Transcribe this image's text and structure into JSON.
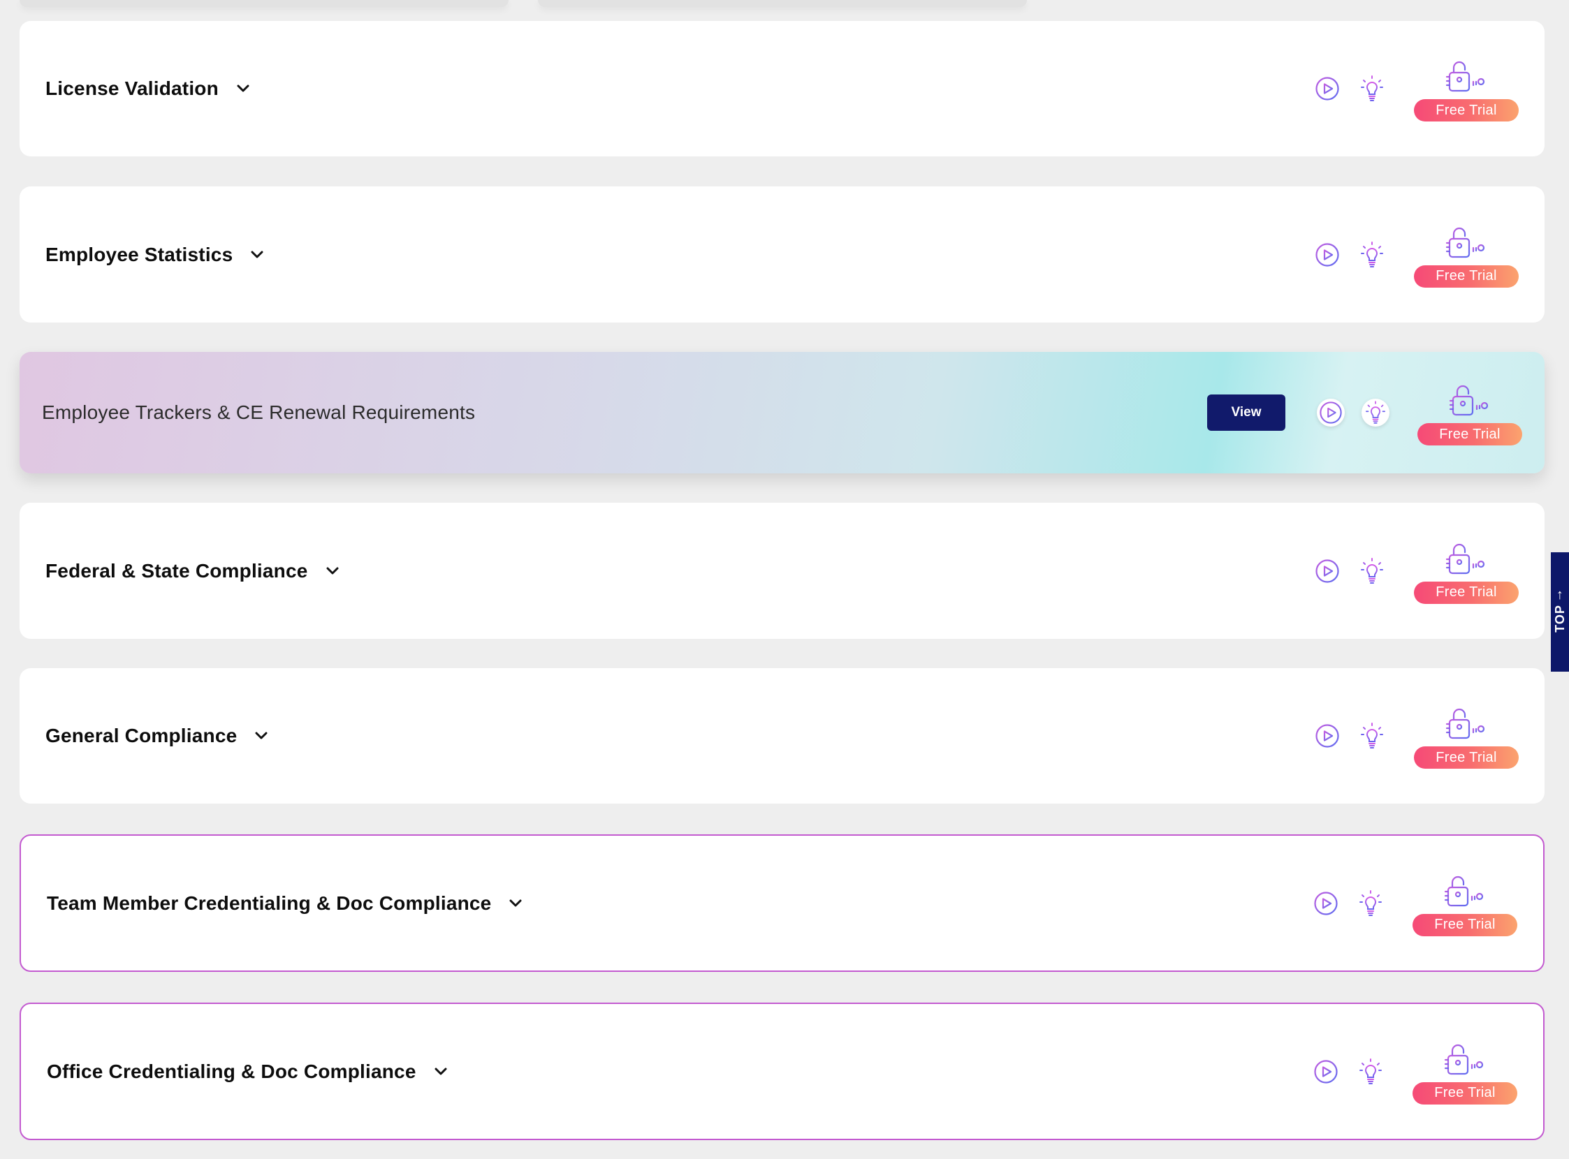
{
  "colors": {
    "page_background": "#eeeeee",
    "card_background": "#ffffff",
    "outline_accent": "#c35ad0",
    "trial_gradient_start": "#f64a77",
    "trial_gradient_end": "#fba36e",
    "view_button": "#111a6b",
    "top_tab": "#0d1869",
    "icon_purple": "#8c5cf0"
  },
  "icons": {
    "expand": "chevron-down-icon",
    "video": "play-icon",
    "tips": "lightbulb-icon",
    "locked": "lock-key-icon"
  },
  "rows": [
    {
      "title": "License Validation",
      "trial_label": "Free Trial"
    },
    {
      "title": "Employee Statistics",
      "trial_label": "Free Trial"
    },
    {
      "title": "Employee Trackers & CE Renewal Requirements",
      "view_label": "View",
      "trial_label": "Free Trial"
    },
    {
      "title": "Federal & State Compliance",
      "trial_label": "Free Trial"
    },
    {
      "title": "General Compliance",
      "trial_label": "Free Trial"
    },
    {
      "title": "Team Member Credentialing & Doc Compliance",
      "trial_label": "Free Trial"
    },
    {
      "title": "Office Credentialing & Doc Compliance",
      "trial_label": "Free Trial"
    }
  ],
  "scroll_top": {
    "label": "TOP",
    "arrow": "↑"
  }
}
